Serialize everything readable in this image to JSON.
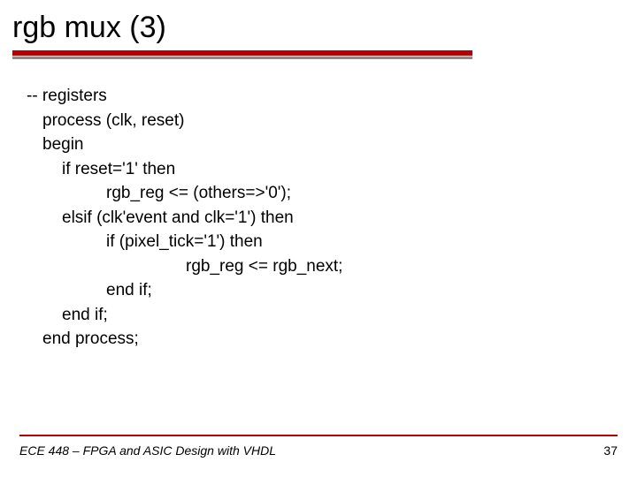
{
  "title": "rgb mux (3)",
  "code": {
    "l1": "-- registers",
    "l2": "process (clk, reset)",
    "l3": "begin",
    "l4": "if reset='1' then",
    "l5": "rgb_reg <= (others=>'0');",
    "l6": "elsif (clk'event and clk='1') then",
    "l7": "if (pixel_tick='1') then",
    "l8": "rgb_reg <= rgb_next;",
    "l9": "end if;",
    "l10": "end if;",
    "l11": "end process;"
  },
  "footer": "ECE 448 – FPGA and ASIC Design with VHDL",
  "page": "37"
}
